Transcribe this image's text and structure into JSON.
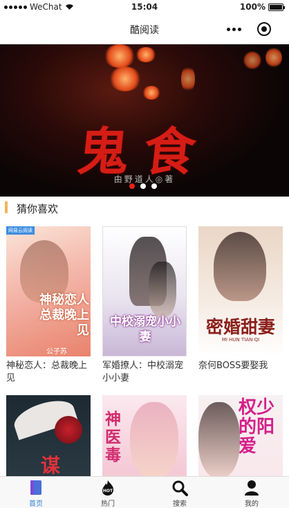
{
  "status_bar": {
    "carrier": "WeChat",
    "time": "15:04",
    "battery": "100%"
  },
  "nav": {
    "title": "酷阅读"
  },
  "banner": {
    "title": "鬼食",
    "author": "由野道人◎著"
  },
  "section": {
    "title": "猜你喜欢"
  },
  "books": [
    {
      "name": "神秘恋人：总裁晚上见",
      "cover_text": "神秘恋人 总裁晚上见",
      "cover_author": "公子苏",
      "badge": "网易云阅读"
    },
    {
      "name": "军婚撩人：中校溺宠小小妻",
      "cover_text": "中校溺宠小小妻"
    },
    {
      "name": "奈何BOSS要娶我",
      "cover_text": "密婚甜妻",
      "cover_sub": "MI HUN TIAN QI"
    },
    {
      "name": "",
      "cover_text": "谋"
    },
    {
      "name": "",
      "cover_text": "神医毒"
    },
    {
      "name": "",
      "cover_text": "权少的阳爱"
    }
  ],
  "tabs": [
    {
      "label": "首页",
      "icon": "book-icon"
    },
    {
      "label": "热门",
      "icon": "hot-fire-icon"
    },
    {
      "label": "搜索",
      "icon": "search-icon"
    },
    {
      "label": "我的",
      "icon": "user-icon"
    }
  ],
  "colors": {
    "accent": "#2d7fd2",
    "section_bar": "#f3b35a",
    "indicator_active": "#e62117",
    "banner_title": "#d51d15"
  }
}
